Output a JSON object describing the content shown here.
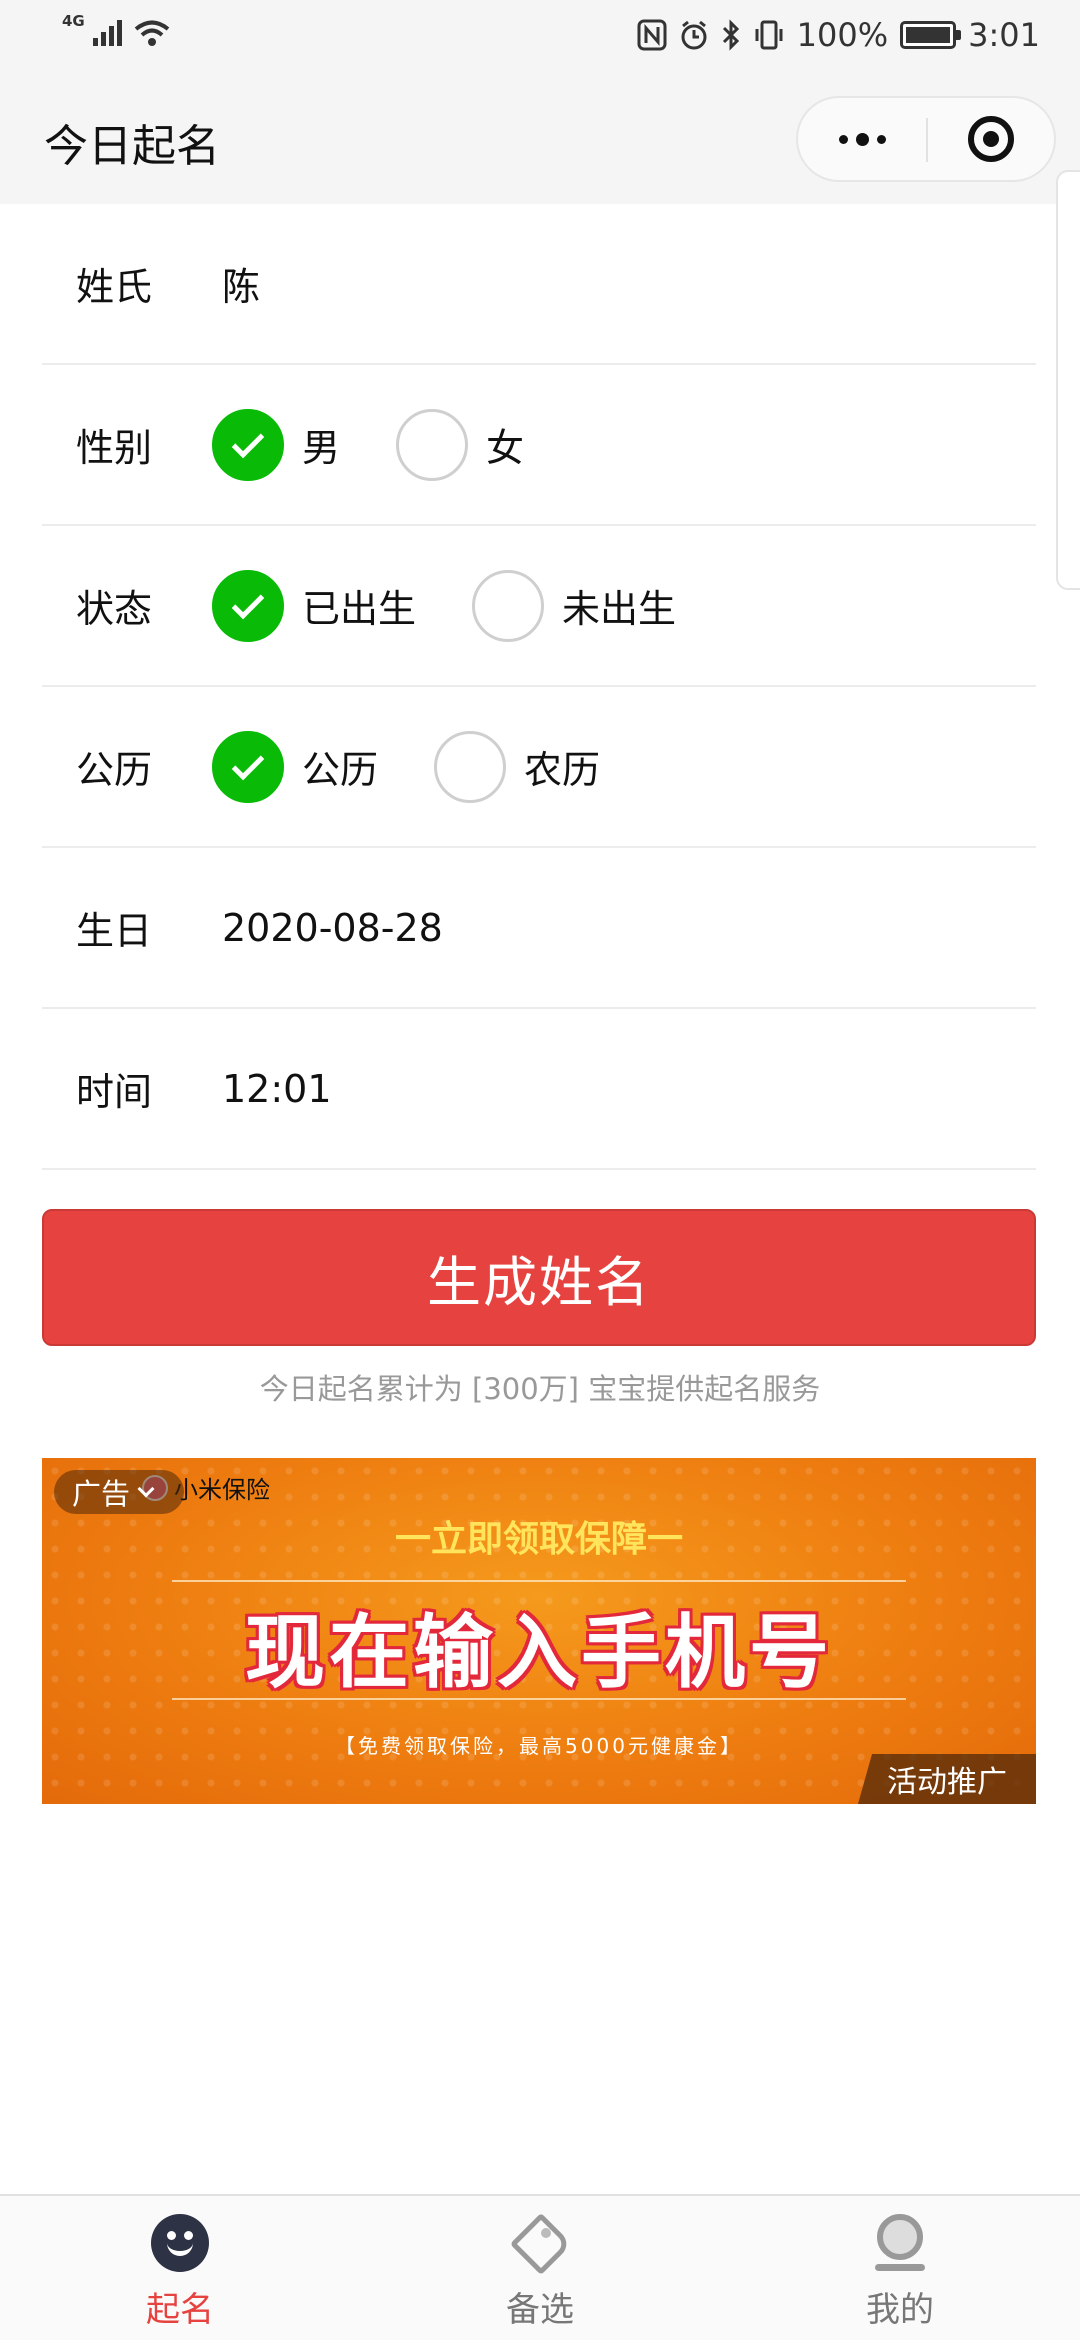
{
  "status_bar": {
    "network": "4G",
    "battery": "100%",
    "battery_level": 1.0,
    "time": "3:01",
    "icons": [
      "signal-icon",
      "wifi-icon",
      "nfc-icon",
      "alarm-icon",
      "bluetooth-icon",
      "vibrate-icon",
      "battery-icon"
    ]
  },
  "nav": {
    "title": "今日起名",
    "more_icon": "more-dots-icon",
    "close_icon": "target-close-icon"
  },
  "form": {
    "surname": {
      "label": "姓氏",
      "value": "陈"
    },
    "gender": {
      "label": "性别",
      "options": [
        {
          "label": "男",
          "checked": true
        },
        {
          "label": "女",
          "checked": false
        }
      ]
    },
    "status": {
      "label": "状态",
      "options": [
        {
          "label": "已出生",
          "checked": true
        },
        {
          "label": "未出生",
          "checked": false
        }
      ]
    },
    "calendar": {
      "label": "公历",
      "options": [
        {
          "label": "公历",
          "checked": true
        },
        {
          "label": "农历",
          "checked": false
        }
      ]
    },
    "birthday": {
      "label": "生日",
      "value": "2020-08-28"
    },
    "time": {
      "label": "时间",
      "value": "12:01"
    }
  },
  "submit": {
    "label": "生成姓名",
    "color": "#e64340"
  },
  "note": "今日起名累计为 [300万] 宝宝提供起名服务",
  "ad": {
    "tag": "广告",
    "brand": "小米保险",
    "subtitle": "一立即领取保障一",
    "headline": "现在输入手机号",
    "fine_print": "【免费领取保险，最高5000元健康金】",
    "promo": "活动推广"
  },
  "tabbar": {
    "accent": "#e64340",
    "items": [
      {
        "label": "起名",
        "icon": "smiley-face-icon",
        "active": true
      },
      {
        "label": "备选",
        "icon": "tag-icon",
        "active": false
      },
      {
        "label": "我的",
        "icon": "profile-icon",
        "active": false
      }
    ]
  }
}
